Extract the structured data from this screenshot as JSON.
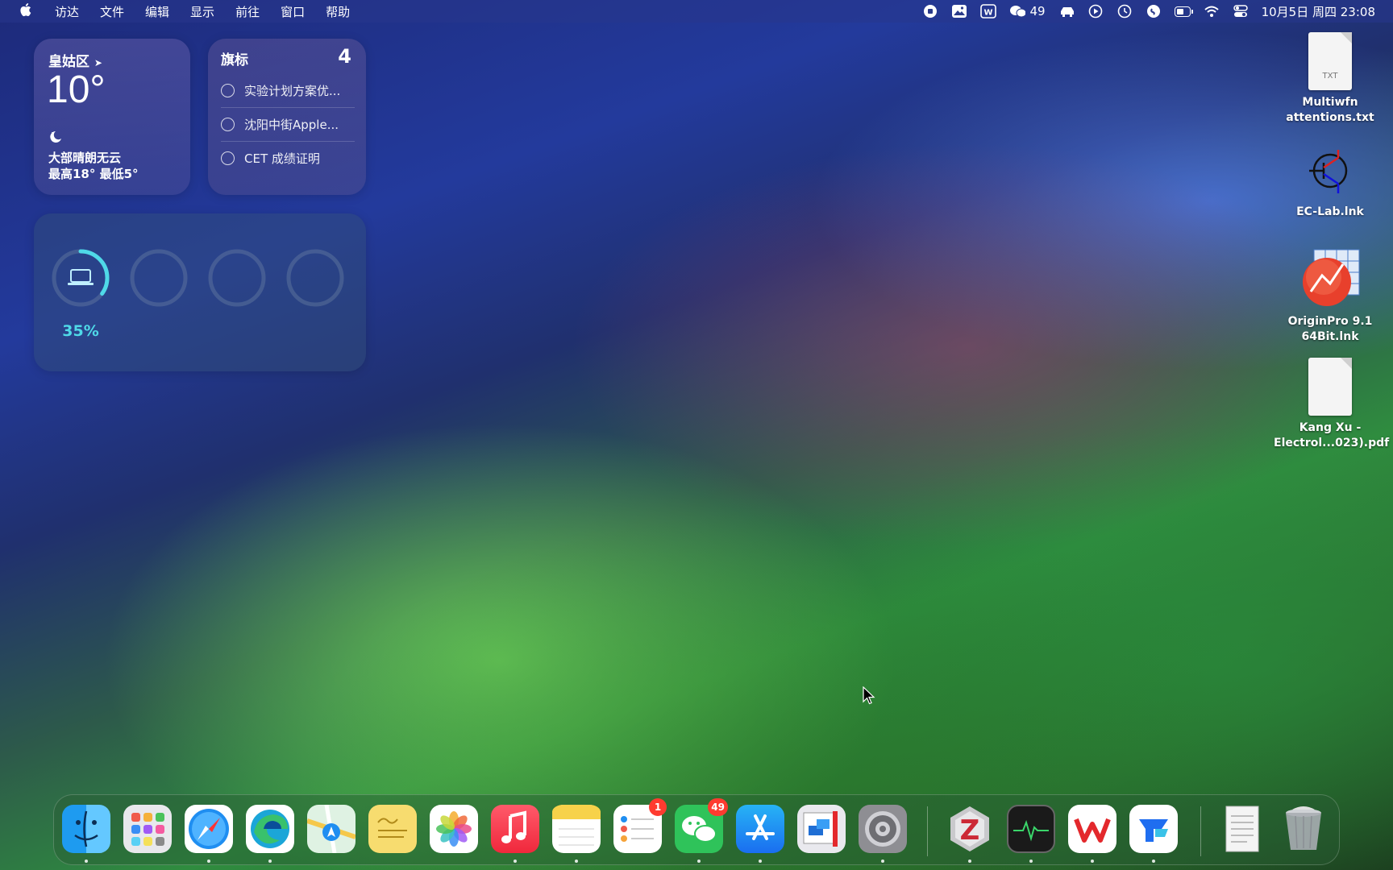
{
  "menubar": {
    "apple_icon": "apple-logo-icon",
    "menus": [
      "访达",
      "文件",
      "编辑",
      "显示",
      "前往",
      "窗口",
      "帮助"
    ],
    "wechat_count": "49",
    "datetime": "10月5日 周四 23:08",
    "status_icons": [
      "screen-record-icon",
      "photo-icon",
      "wps-icon",
      "wechat-icon",
      "car-icon",
      "play-icon",
      "time-machine-icon",
      "shazam-icon",
      "battery-icon",
      "wifi-icon",
      "control-center-icon"
    ]
  },
  "weather_widget": {
    "location": "皇姑区",
    "temperature": "10°",
    "condition": "大部晴朗无云",
    "range": "最高18° 最低5°"
  },
  "reminders_widget": {
    "title": "旗标",
    "count": "4",
    "items": [
      "实验计划方案优...",
      "沈阳中街Apple...",
      "CET 成绩证明"
    ]
  },
  "battery_widget": {
    "percent_label": "35%",
    "level": 0.35,
    "ring_color": "#4fd9e8"
  },
  "desktop_icons": [
    {
      "line1": "Multiwfn",
      "line2": "attentions.txt",
      "type_label": "TXT"
    },
    {
      "line1": "EC-Lab.lnk",
      "line2": ""
    },
    {
      "line1": "OriginPro 9.1",
      "line2": "64Bit.lnk"
    },
    {
      "line1": "Kang Xu -",
      "line2": "Electrol...023).pdf"
    }
  ],
  "dock": {
    "apps": [
      {
        "name": "finder"
      },
      {
        "name": "launchpad"
      },
      {
        "name": "safari"
      },
      {
        "name": "edge"
      },
      {
        "name": "maps"
      },
      {
        "name": "stickies"
      },
      {
        "name": "photos"
      },
      {
        "name": "music"
      },
      {
        "name": "notes"
      },
      {
        "name": "reminders",
        "badge": "1"
      },
      {
        "name": "wechat",
        "badge": "49"
      },
      {
        "name": "app-store"
      },
      {
        "name": "parallels"
      },
      {
        "name": "system-settings"
      },
      {
        "name": "zotero"
      },
      {
        "name": "activity-monitor"
      },
      {
        "name": "wps"
      },
      {
        "name": "lark"
      },
      {
        "name": "documents"
      },
      {
        "name": "trash"
      }
    ]
  }
}
